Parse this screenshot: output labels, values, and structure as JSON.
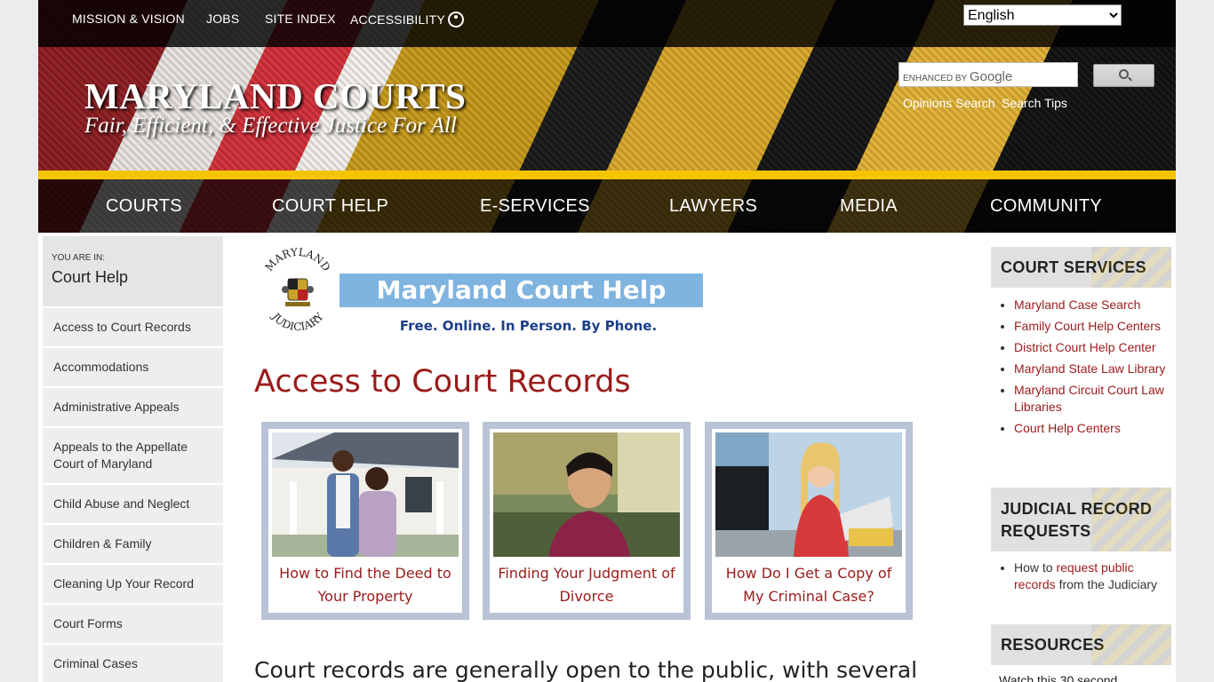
{
  "topbar": {
    "links": [
      "MISSION & VISION",
      "JOBS",
      "SITE INDEX",
      "ACCESSIBILITY"
    ],
    "language": "English"
  },
  "header": {
    "title": "MARYLAND COURTS",
    "tagline": "Fair, Efficient, & Effective Justice For All",
    "search_brand": "ENHANCED BY",
    "search_brand_google": "Google",
    "sub_links": [
      "Opinions Search",
      "Search Tips"
    ]
  },
  "nav": [
    "COURTS",
    "COURT HELP",
    "E-SERVICES",
    "LAWYERS",
    "MEDIA",
    "COMMUNITY"
  ],
  "sidebar": {
    "you_are_in": "YOU ARE IN:",
    "section": "Court Help",
    "items": [
      "Access to Court Records",
      "Accommodations",
      "Administrative Appeals",
      "Appeals to the Appellate Court of Maryland",
      "Child Abuse and Neglect",
      "Children & Family",
      "Cleaning Up Your Record",
      "Court Forms",
      "Criminal Cases"
    ]
  },
  "banner": {
    "seal_top": "MARYLAND",
    "seal_bottom": "JUDICIARY",
    "title": "Maryland Court Help",
    "subtitle": "Free. Online. In Person. By Phone."
  },
  "main": {
    "heading": "Access to Court Records",
    "cards": [
      "How to Find the Deed to Your Property",
      "Finding Your Judgment of Divorce",
      "How Do I Get a Copy of My Criminal Case?"
    ],
    "intro": "Court records are generally open to the public, with several"
  },
  "right": {
    "court_services_title": "COURT SERVICES",
    "court_services": [
      "Maryland Case Search",
      "Family Court Help Centers",
      "District Court Help Center",
      "Maryland State Law Library",
      "Maryland Circuit Court Law Libraries",
      "Court Help Centers"
    ],
    "record_requests_title": "JUDICIAL RECORD REQUESTS",
    "record_requests_pre": "How to ",
    "record_requests_link": "request public records",
    "record_requests_post": " from the Judiciary",
    "resources_title": "RESOURCES",
    "resources_text": "Watch this 30 second"
  },
  "colors": {
    "accent": "#9b1b1b",
    "nav_bar": "#f5c400",
    "banner_blue": "#7fb3e0",
    "card_border": "#b9c3d6"
  }
}
